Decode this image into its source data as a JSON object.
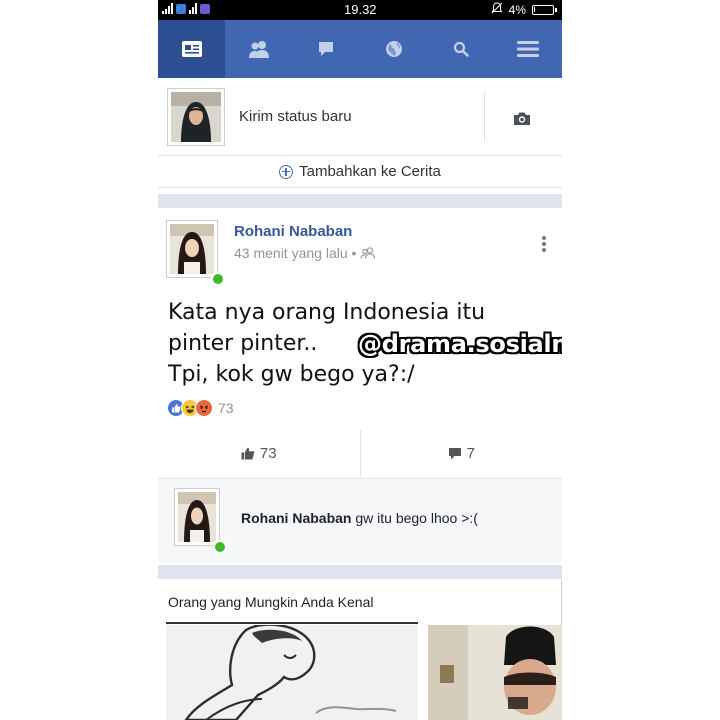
{
  "status_bar": {
    "time": "19.32",
    "battery": "4%",
    "battery_level": 0.04
  },
  "nav": {
    "tabs": [
      {
        "name": "news-feed",
        "icon": "news-feed-icon",
        "active": true
      },
      {
        "name": "friend-requests",
        "icon": "friends-icon",
        "active": false
      },
      {
        "name": "messages",
        "icon": "messages-icon",
        "active": false
      },
      {
        "name": "notifications",
        "icon": "globe-icon",
        "active": false
      },
      {
        "name": "search",
        "icon": "search-icon",
        "active": false
      },
      {
        "name": "menu",
        "icon": "menu-icon",
        "active": false
      }
    ]
  },
  "composer": {
    "placeholder": "Kirim status baru",
    "camera_icon": "camera-icon"
  },
  "story": {
    "label": "Tambahkan ke Cerita"
  },
  "post": {
    "author": "Rohani Nababan",
    "time": "43 menit yang lalu",
    "audience_icon": "friends-icon",
    "text_lines": [
      "Kata nya orang Indonesia itu",
      "pinter pinter..",
      "Tpi, kok gw bego ya?:/"
    ],
    "reaction_count": "73",
    "reactions": [
      "like",
      "haha",
      "angry"
    ],
    "actions": {
      "like_count": "73",
      "comment_count": "7"
    }
  },
  "comment": {
    "author": "Rohani Nababan",
    "text": "gw itu bego lhoo >:("
  },
  "pymk": {
    "title": "Orang yang Mungkin Anda Kenal"
  },
  "watermark": "@drama.sosialmedia",
  "colors": {
    "navbar": "#4267b2",
    "navbar_active": "#2d4f91",
    "link": "#365899",
    "online": "#42b72a",
    "separator": "#dfe3ee"
  }
}
